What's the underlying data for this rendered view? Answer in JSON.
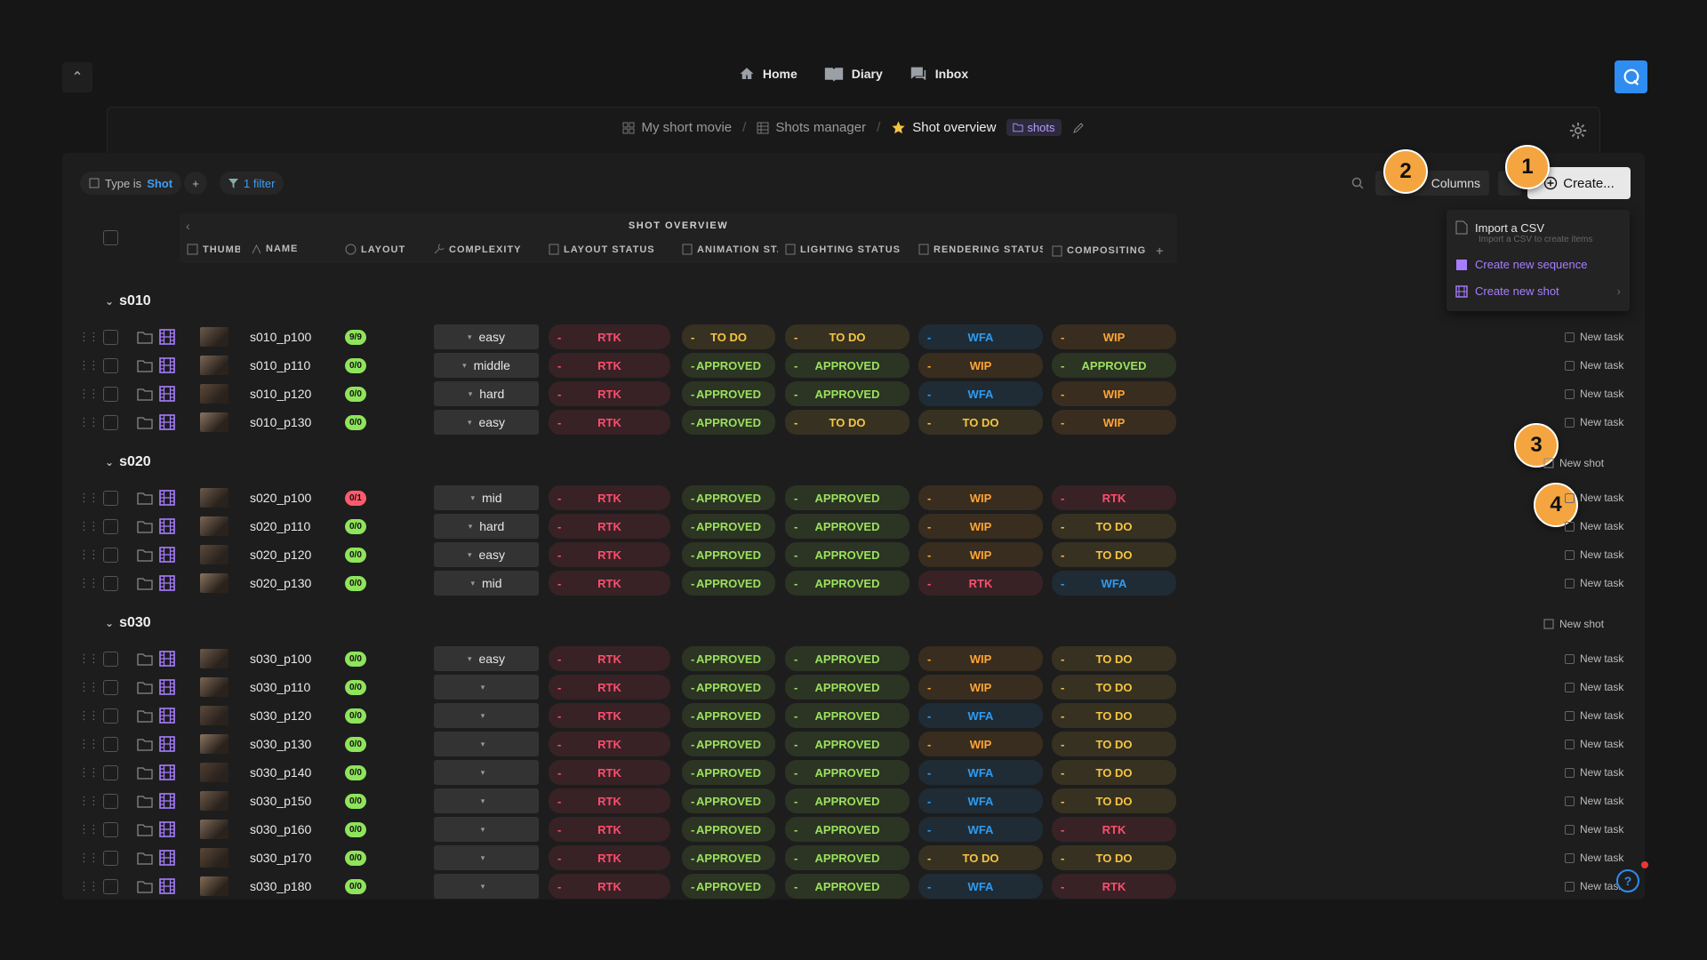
{
  "nav": {
    "collapse_icon": "chevron-up-icon",
    "items": [
      {
        "label": "Home",
        "icon": "home-icon"
      },
      {
        "label": "Diary",
        "icon": "diary-icon"
      },
      {
        "label": "Inbox",
        "icon": "inbox-icon"
      }
    ]
  },
  "breadcrumb": {
    "project": "My short movie",
    "manager": "Shots manager",
    "current": "Shot overview",
    "tag": "shots"
  },
  "filters": {
    "type_prefix": "Type is",
    "type_value": "Shot",
    "add_label": "+",
    "filter_label": "1 filter"
  },
  "toolbar": {
    "columns_label": "Columns",
    "create_label": "Create..."
  },
  "create_menu": {
    "import_label": "Import a CSV",
    "import_sub": "Import a CSV to create items",
    "sequence_label": "Create new sequence",
    "shot_label": "Create new shot"
  },
  "callouts": [
    "1",
    "2",
    "3",
    "4"
  ],
  "table": {
    "group_title": "SHOT OVERVIEW",
    "columns": [
      "THUMB",
      "NAME",
      "LAYOUT",
      "COMPLEXITY",
      "LAYOUT STATUS",
      "ANIMATION STATUS",
      "LIGHTING STATUS",
      "RENDERING STATUS",
      "COMPOSITING"
    ],
    "new_task_label": "New task",
    "new_shot_label": "New shot"
  },
  "colors": {
    "RTK": "#ff4d6d",
    "TO DO": "#f5c542",
    "APPROVED": "#9be15d",
    "WFA": "#2f9bf0",
    "WIP": "#ffa534",
    "accent": "#2f8cf0",
    "purple": "#a77dff"
  },
  "sequences": [
    {
      "name": "s010",
      "rows": [
        {
          "name": "s010_p100",
          "layout": "9/9",
          "complexity": "easy",
          "s": [
            "RTK",
            "TO DO",
            "TO DO",
            "WFA",
            "WIP"
          ]
        },
        {
          "name": "s010_p110",
          "layout": "0/0",
          "complexity": "middle",
          "s": [
            "RTK",
            "APPROVED",
            "APPROVED",
            "WIP",
            "APPROVED"
          ]
        },
        {
          "name": "s010_p120",
          "layout": "0/0",
          "complexity": "hard",
          "s": [
            "RTK",
            "APPROVED",
            "APPROVED",
            "WFA",
            "WIP"
          ]
        },
        {
          "name": "s010_p130",
          "layout": "0/0",
          "complexity": "easy",
          "s": [
            "RTK",
            "APPROVED",
            "TO DO",
            "TO DO",
            "WIP"
          ]
        }
      ]
    },
    {
      "name": "s020",
      "rows": [
        {
          "name": "s020_p100",
          "layout": "0/1",
          "complexity": "mid",
          "s": [
            "RTK",
            "APPROVED",
            "APPROVED",
            "WIP",
            "RTK"
          ]
        },
        {
          "name": "s020_p110",
          "layout": "0/0",
          "complexity": "hard",
          "s": [
            "RTK",
            "APPROVED",
            "APPROVED",
            "WIP",
            "TO DO"
          ]
        },
        {
          "name": "s020_p120",
          "layout": "0/0",
          "complexity": "easy",
          "s": [
            "RTK",
            "APPROVED",
            "APPROVED",
            "WIP",
            "TO DO"
          ]
        },
        {
          "name": "s020_p130",
          "layout": "0/0",
          "complexity": "mid",
          "s": [
            "RTK",
            "APPROVED",
            "APPROVED",
            "RTK",
            "WFA"
          ]
        }
      ]
    },
    {
      "name": "s030",
      "rows": [
        {
          "name": "s030_p100",
          "layout": "0/0",
          "complexity": "easy",
          "s": [
            "RTK",
            "APPROVED",
            "APPROVED",
            "WIP",
            "TO DO"
          ]
        },
        {
          "name": "s030_p110",
          "layout": "0/0",
          "complexity": "",
          "s": [
            "RTK",
            "APPROVED",
            "APPROVED",
            "WIP",
            "TO DO"
          ]
        },
        {
          "name": "s030_p120",
          "layout": "0/0",
          "complexity": "",
          "s": [
            "RTK",
            "APPROVED",
            "APPROVED",
            "WFA",
            "TO DO"
          ]
        },
        {
          "name": "s030_p130",
          "layout": "0/0",
          "complexity": "",
          "s": [
            "RTK",
            "APPROVED",
            "APPROVED",
            "WIP",
            "TO DO"
          ]
        },
        {
          "name": "s030_p140",
          "layout": "0/0",
          "complexity": "",
          "s": [
            "RTK",
            "APPROVED",
            "APPROVED",
            "WFA",
            "TO DO"
          ]
        },
        {
          "name": "s030_p150",
          "layout": "0/0",
          "complexity": "",
          "s": [
            "RTK",
            "APPROVED",
            "APPROVED",
            "WFA",
            "TO DO"
          ]
        },
        {
          "name": "s030_p160",
          "layout": "0/0",
          "complexity": "",
          "s": [
            "RTK",
            "APPROVED",
            "APPROVED",
            "WFA",
            "RTK"
          ]
        },
        {
          "name": "s030_p170",
          "layout": "0/0",
          "complexity": "",
          "s": [
            "RTK",
            "APPROVED",
            "APPROVED",
            "TO DO",
            "TO DO"
          ]
        },
        {
          "name": "s030_p180",
          "layout": "0/0",
          "complexity": "",
          "s": [
            "RTK",
            "APPROVED",
            "APPROVED",
            "WFA",
            "RTK"
          ]
        }
      ]
    }
  ]
}
